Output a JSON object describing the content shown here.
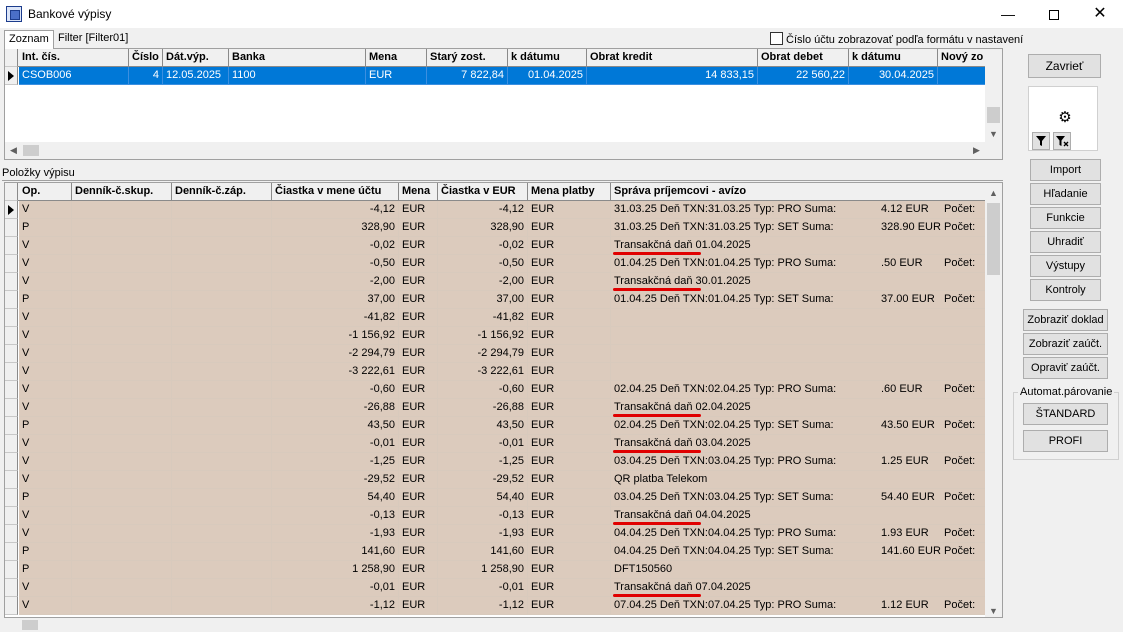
{
  "window": {
    "title": "Bankové výpisy",
    "minimize": "—",
    "close": "✕"
  },
  "tabs": [
    {
      "label": "Zoznam",
      "active": true
    },
    {
      "label": "Filter [Filter01]",
      "active": false
    }
  ],
  "account_format_checkbox": {
    "label": "Číslo účtu zobrazovať podľa formátu v nastavení",
    "checked": false
  },
  "statements": {
    "columns": [
      "Int. čís.",
      "Číslo",
      "Dát.výp.",
      "Banka",
      "Mena",
      "Starý zost.",
      "k dátumu",
      "Obrat kredit",
      "Obrat debet",
      "k dátumu",
      "Nový zo"
    ],
    "rows": [
      [
        "CSOB006",
        "4",
        "12.05.2025",
        "1100",
        "EUR",
        "7 822,84",
        "01.04.2025",
        "14 833,15",
        "22 560,22",
        "30.04.2025",
        ""
      ]
    ]
  },
  "items_section_label": "Položky výpisu",
  "items": {
    "columns": [
      "Op.",
      "Denník-č.skup.",
      "Denník-č.záp.",
      "Čiastka v mene účtu",
      "Mena",
      "Čiastka v EUR",
      "Mena platby",
      "Správa príjemcovi - avízo"
    ],
    "rows": [
      {
        "op": "V",
        "amount": "-4,12",
        "cur": "EUR",
        "amount_eur": "-4,12",
        "pay_cur": "EUR",
        "msg": "31.03.25  Deň TXN:31.03.25  Typ: PRO  Suma:",
        "suma": "4.12  EUR",
        "pocet": "Počet:",
        "red": false
      },
      {
        "op": "P",
        "amount": "328,90",
        "cur": "EUR",
        "amount_eur": "328,90",
        "pay_cur": "EUR",
        "msg": "31.03.25  Deň TXN:31.03.25  Typ: SET  Suma:",
        "suma": "328.90  EUR",
        "pocet": "Počet:",
        "red": false
      },
      {
        "op": "V",
        "amount": "-0,02",
        "cur": "EUR",
        "amount_eur": "-0,02",
        "pay_cur": "EUR",
        "msg": "Transakčná daň 01.04.2025",
        "suma": "",
        "pocet": "",
        "red": true
      },
      {
        "op": "V",
        "amount": "-0,50",
        "cur": "EUR",
        "amount_eur": "-0,50",
        "pay_cur": "EUR",
        "msg": "01.04.25  Deň TXN:01.04.25  Typ: PRO  Suma:",
        "suma": ".50  EUR",
        "pocet": "Počet:",
        "red": false
      },
      {
        "op": "V",
        "amount": "-2,00",
        "cur": "EUR",
        "amount_eur": "-2,00",
        "pay_cur": "EUR",
        "msg": "Transakčná daň 30.01.2025",
        "suma": "",
        "pocet": "",
        "red": true
      },
      {
        "op": "P",
        "amount": "37,00",
        "cur": "EUR",
        "amount_eur": "37,00",
        "pay_cur": "EUR",
        "msg": "01.04.25  Deň TXN:01.04.25  Typ: SET  Suma:",
        "suma": "37.00  EUR",
        "pocet": "Počet:",
        "red": false
      },
      {
        "op": "V",
        "amount": "-41,82",
        "cur": "EUR",
        "amount_eur": "-41,82",
        "pay_cur": "EUR",
        "msg": "",
        "suma": "",
        "pocet": "",
        "red": false
      },
      {
        "op": "V",
        "amount": "-1 156,92",
        "cur": "EUR",
        "amount_eur": "-1 156,92",
        "pay_cur": "EUR",
        "msg": "",
        "suma": "",
        "pocet": "",
        "red": false
      },
      {
        "op": "V",
        "amount": "-2 294,79",
        "cur": "EUR",
        "amount_eur": "-2 294,79",
        "pay_cur": "EUR",
        "msg": "",
        "suma": "",
        "pocet": "",
        "red": false
      },
      {
        "op": "V",
        "amount": "-3 222,61",
        "cur": "EUR",
        "amount_eur": "-3 222,61",
        "pay_cur": "EUR",
        "msg": "",
        "suma": "",
        "pocet": "",
        "red": false
      },
      {
        "op": "V",
        "amount": "-0,60",
        "cur": "EUR",
        "amount_eur": "-0,60",
        "pay_cur": "EUR",
        "msg": "02.04.25  Deň TXN:02.04.25  Typ: PRO  Suma:",
        "suma": ".60  EUR",
        "pocet": "Počet:",
        "red": false
      },
      {
        "op": "V",
        "amount": "-26,88",
        "cur": "EUR",
        "amount_eur": "-26,88",
        "pay_cur": "EUR",
        "msg": "Transakčná daň 02.04.2025",
        "suma": "",
        "pocet": "",
        "red": true
      },
      {
        "op": "P",
        "amount": "43,50",
        "cur": "EUR",
        "amount_eur": "43,50",
        "pay_cur": "EUR",
        "msg": "02.04.25  Deň TXN:02.04.25  Typ: SET  Suma:",
        "suma": "43.50  EUR",
        "pocet": "Počet:",
        "red": false
      },
      {
        "op": "V",
        "amount": "-0,01",
        "cur": "EUR",
        "amount_eur": "-0,01",
        "pay_cur": "EUR",
        "msg": "Transakčná daň 03.04.2025",
        "suma": "",
        "pocet": "",
        "red": true
      },
      {
        "op": "V",
        "amount": "-1,25",
        "cur": "EUR",
        "amount_eur": "-1,25",
        "pay_cur": "EUR",
        "msg": "03.04.25  Deň TXN:03.04.25  Typ: PRO  Suma:",
        "suma": "1.25  EUR",
        "pocet": "Počet:",
        "red": false
      },
      {
        "op": "V",
        "amount": "-29,52",
        "cur": "EUR",
        "amount_eur": "-29,52",
        "pay_cur": "EUR",
        "msg": "QR platba Telekom",
        "suma": "",
        "pocet": "",
        "red": false
      },
      {
        "op": "P",
        "amount": "54,40",
        "cur": "EUR",
        "amount_eur": "54,40",
        "pay_cur": "EUR",
        "msg": "03.04.25  Deň TXN:03.04.25  Typ: SET  Suma:",
        "suma": "54.40  EUR",
        "pocet": "Počet:",
        "red": false
      },
      {
        "op": "V",
        "amount": "-0,13",
        "cur": "EUR",
        "amount_eur": "-0,13",
        "pay_cur": "EUR",
        "msg": "Transakčná daň 04.04.2025",
        "suma": "",
        "pocet": "",
        "red": true
      },
      {
        "op": "V",
        "amount": "-1,93",
        "cur": "EUR",
        "amount_eur": "-1,93",
        "pay_cur": "EUR",
        "msg": "04.04.25  Deň TXN:04.04.25  Typ: PRO  Suma:",
        "suma": "1.93  EUR",
        "pocet": "Počet:",
        "red": false
      },
      {
        "op": "P",
        "amount": "141,60",
        "cur": "EUR",
        "amount_eur": "141,60",
        "pay_cur": "EUR",
        "msg": "04.04.25  Deň TXN:04.04.25  Typ: SET  Suma:",
        "suma": "141.60  EUR",
        "pocet": "Počet:",
        "red": false
      },
      {
        "op": "P",
        "amount": "1 258,90",
        "cur": "EUR",
        "amount_eur": "1 258,90",
        "pay_cur": "EUR",
        "msg": "DFT150560",
        "suma": "",
        "pocet": "",
        "red": false
      },
      {
        "op": "V",
        "amount": "-0,01",
        "cur": "EUR",
        "amount_eur": "-0,01",
        "pay_cur": "EUR",
        "msg": "Transakčná daň 07.04.2025",
        "suma": "",
        "pocet": "",
        "red": true
      },
      {
        "op": "V",
        "amount": "-1,12",
        "cur": "EUR",
        "amount_eur": "-1,12",
        "pay_cur": "EUR",
        "msg": "07.04.25  Deň TXN:07.04.25  Typ: PRO  Suma:",
        "suma": "1.12  EUR",
        "pocet": "Počet:",
        "red": false
      }
    ]
  },
  "buttons": {
    "close": "Zavrieť",
    "import": "Import",
    "search": "Hľadanie",
    "functions": "Funkcie",
    "pay": "Uhradiť",
    "outputs": "Výstupy",
    "checks": "Kontroly",
    "show_document": "Zobraziť doklad",
    "show_posting": "Zobraziť zaúčt.",
    "fix_posting": "Opraviť zaúčt."
  },
  "auto_match": {
    "label": "Automat.párovanie",
    "standard": "ŠTANDARD",
    "profi": "PROFI"
  },
  "colors": {
    "selection": "#0078d7",
    "item_row": "#dccbbd",
    "highlight_underline": "#e00000"
  }
}
